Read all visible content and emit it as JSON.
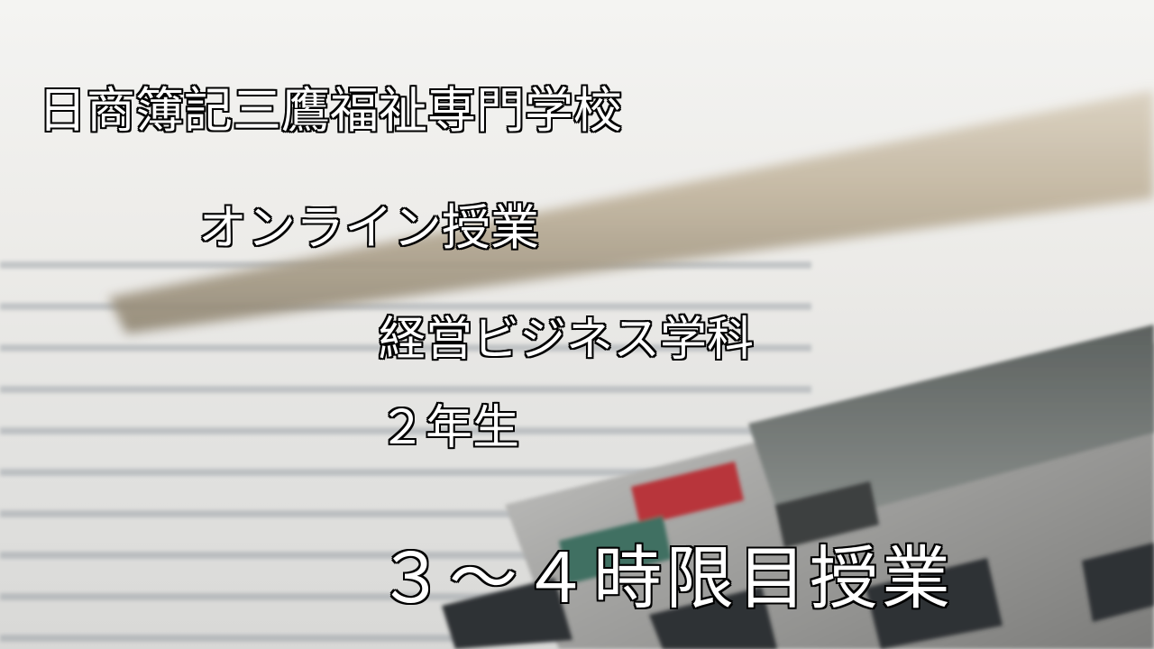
{
  "slide": {
    "school_name": "日商簿記三鷹福祉専門学校",
    "subtitle": "オンライン授業",
    "department": "経営ビジネス学科",
    "grade": "２年生",
    "period": "３～４時限目授業"
  },
  "colors": {
    "text": "#ffffff",
    "outline": "#000000"
  }
}
